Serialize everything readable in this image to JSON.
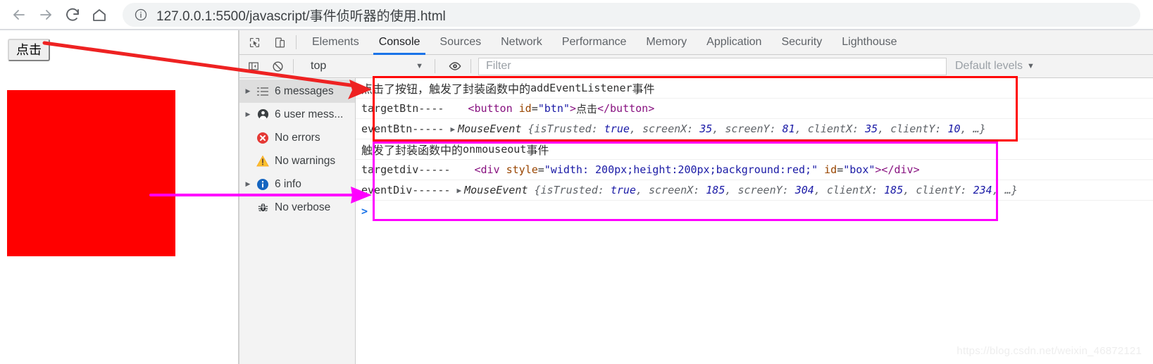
{
  "browser": {
    "nav": {
      "back": "back-arrow",
      "forward": "forward-arrow",
      "reload": "reload",
      "home": "home"
    },
    "omnibox": {
      "info_icon": "info-circle-icon",
      "url": "127.0.0.1:5500/javascript/事件侦听器的使用.html"
    }
  },
  "page": {
    "button_label": "点击",
    "box_color": "#ff0000"
  },
  "devtools": {
    "tools": {
      "inspect": "inspect-element-icon",
      "device": "device-toolbar-icon"
    },
    "tabs": [
      {
        "label": "Elements",
        "active": false
      },
      {
        "label": "Console",
        "active": true
      },
      {
        "label": "Sources",
        "active": false
      },
      {
        "label": "Network",
        "active": false
      },
      {
        "label": "Performance",
        "active": false
      },
      {
        "label": "Memory",
        "active": false
      },
      {
        "label": "Application",
        "active": false
      },
      {
        "label": "Security",
        "active": false
      },
      {
        "label": "Lighthouse",
        "active": false
      }
    ],
    "toolbar": {
      "sidebar_toggle": "console-sidebar-toggle-icon",
      "clear_console": "clear-console-icon",
      "context": "top",
      "context_caret": "▼",
      "eye": "live-expression-icon",
      "filter_placeholder": "Filter",
      "levels_label": "Default levels",
      "levels_caret": "▼"
    },
    "sidebar": [
      {
        "label": "6 messages",
        "icon": "list-icon",
        "expandable": true,
        "selected": true
      },
      {
        "label": "6 user mess...",
        "icon": "user-icon",
        "expandable": true,
        "selected": false
      },
      {
        "label": "No errors",
        "icon": "error-icon",
        "expandable": false,
        "selected": false
      },
      {
        "label": "No warnings",
        "icon": "warning-icon",
        "expandable": false,
        "selected": false
      },
      {
        "label": "6 info",
        "icon": "info-icon",
        "expandable": true,
        "selected": false
      },
      {
        "label": "No verbose",
        "icon": "bug-icon",
        "expandable": false,
        "selected": false
      }
    ],
    "log": {
      "group1": {
        "message": "点击了按钮，触发了封装函数中的",
        "message_mono": "addEventListener",
        "message_tail": "事件",
        "target_label": "targetBtn----",
        "target_open_lt": "<",
        "target_tag": "button",
        "target_attr": "id",
        "target_eq": "=",
        "target_attr_value": "\"btn\"",
        "target_gt": ">",
        "target_text": "点击",
        "target_close": "</button>",
        "event_label": "eventBtn-----",
        "event_disclosure": "▶",
        "event_type": "MouseEvent",
        "event_open": "{isTrusted:",
        "event_is_trusted": "true",
        "event_props": [
          {
            "key": "screenX:",
            "value": "35"
          },
          {
            "key": "screenY:",
            "value": "81"
          },
          {
            "key": "clientX:",
            "value": "35"
          },
          {
            "key": "clientY:",
            "value": "10"
          }
        ],
        "event_tail": "…}"
      },
      "group2": {
        "message": "触发了封装函数中的",
        "message_mono": "onmouseout",
        "message_tail": "事件",
        "target_label": "targetdiv-----",
        "target_open_lt": "<",
        "target_tag": "div",
        "target_attr": "style",
        "target_eq": "=",
        "target_attr_value": "\"width: 200px;height:200px;background:red;\"",
        "target_attr2": "id",
        "target_attr2_value": "\"box\"",
        "target_gt": ">",
        "target_close": "</div>",
        "event_label": "eventDiv------",
        "event_disclosure": "▶",
        "event_type": "MouseEvent",
        "event_open": "{isTrusted:",
        "event_is_trusted": "true",
        "event_props": [
          {
            "key": "screenX:",
            "value": "185"
          },
          {
            "key": "screenY:",
            "value": "304"
          },
          {
            "key": "clientX:",
            "value": "185"
          },
          {
            "key": "clientY:",
            "value": "234"
          }
        ],
        "event_tail": ",  …}"
      },
      "prompt": ">"
    }
  },
  "annotations": {
    "red_box_color": "#ff0000",
    "magenta_box_color": "#ff00ff",
    "red_arrow_color": "#ee2222",
    "magenta_arrow_color": "#ff00ff"
  },
  "watermark": "https://blog.csdn.net/weixin_46872121"
}
